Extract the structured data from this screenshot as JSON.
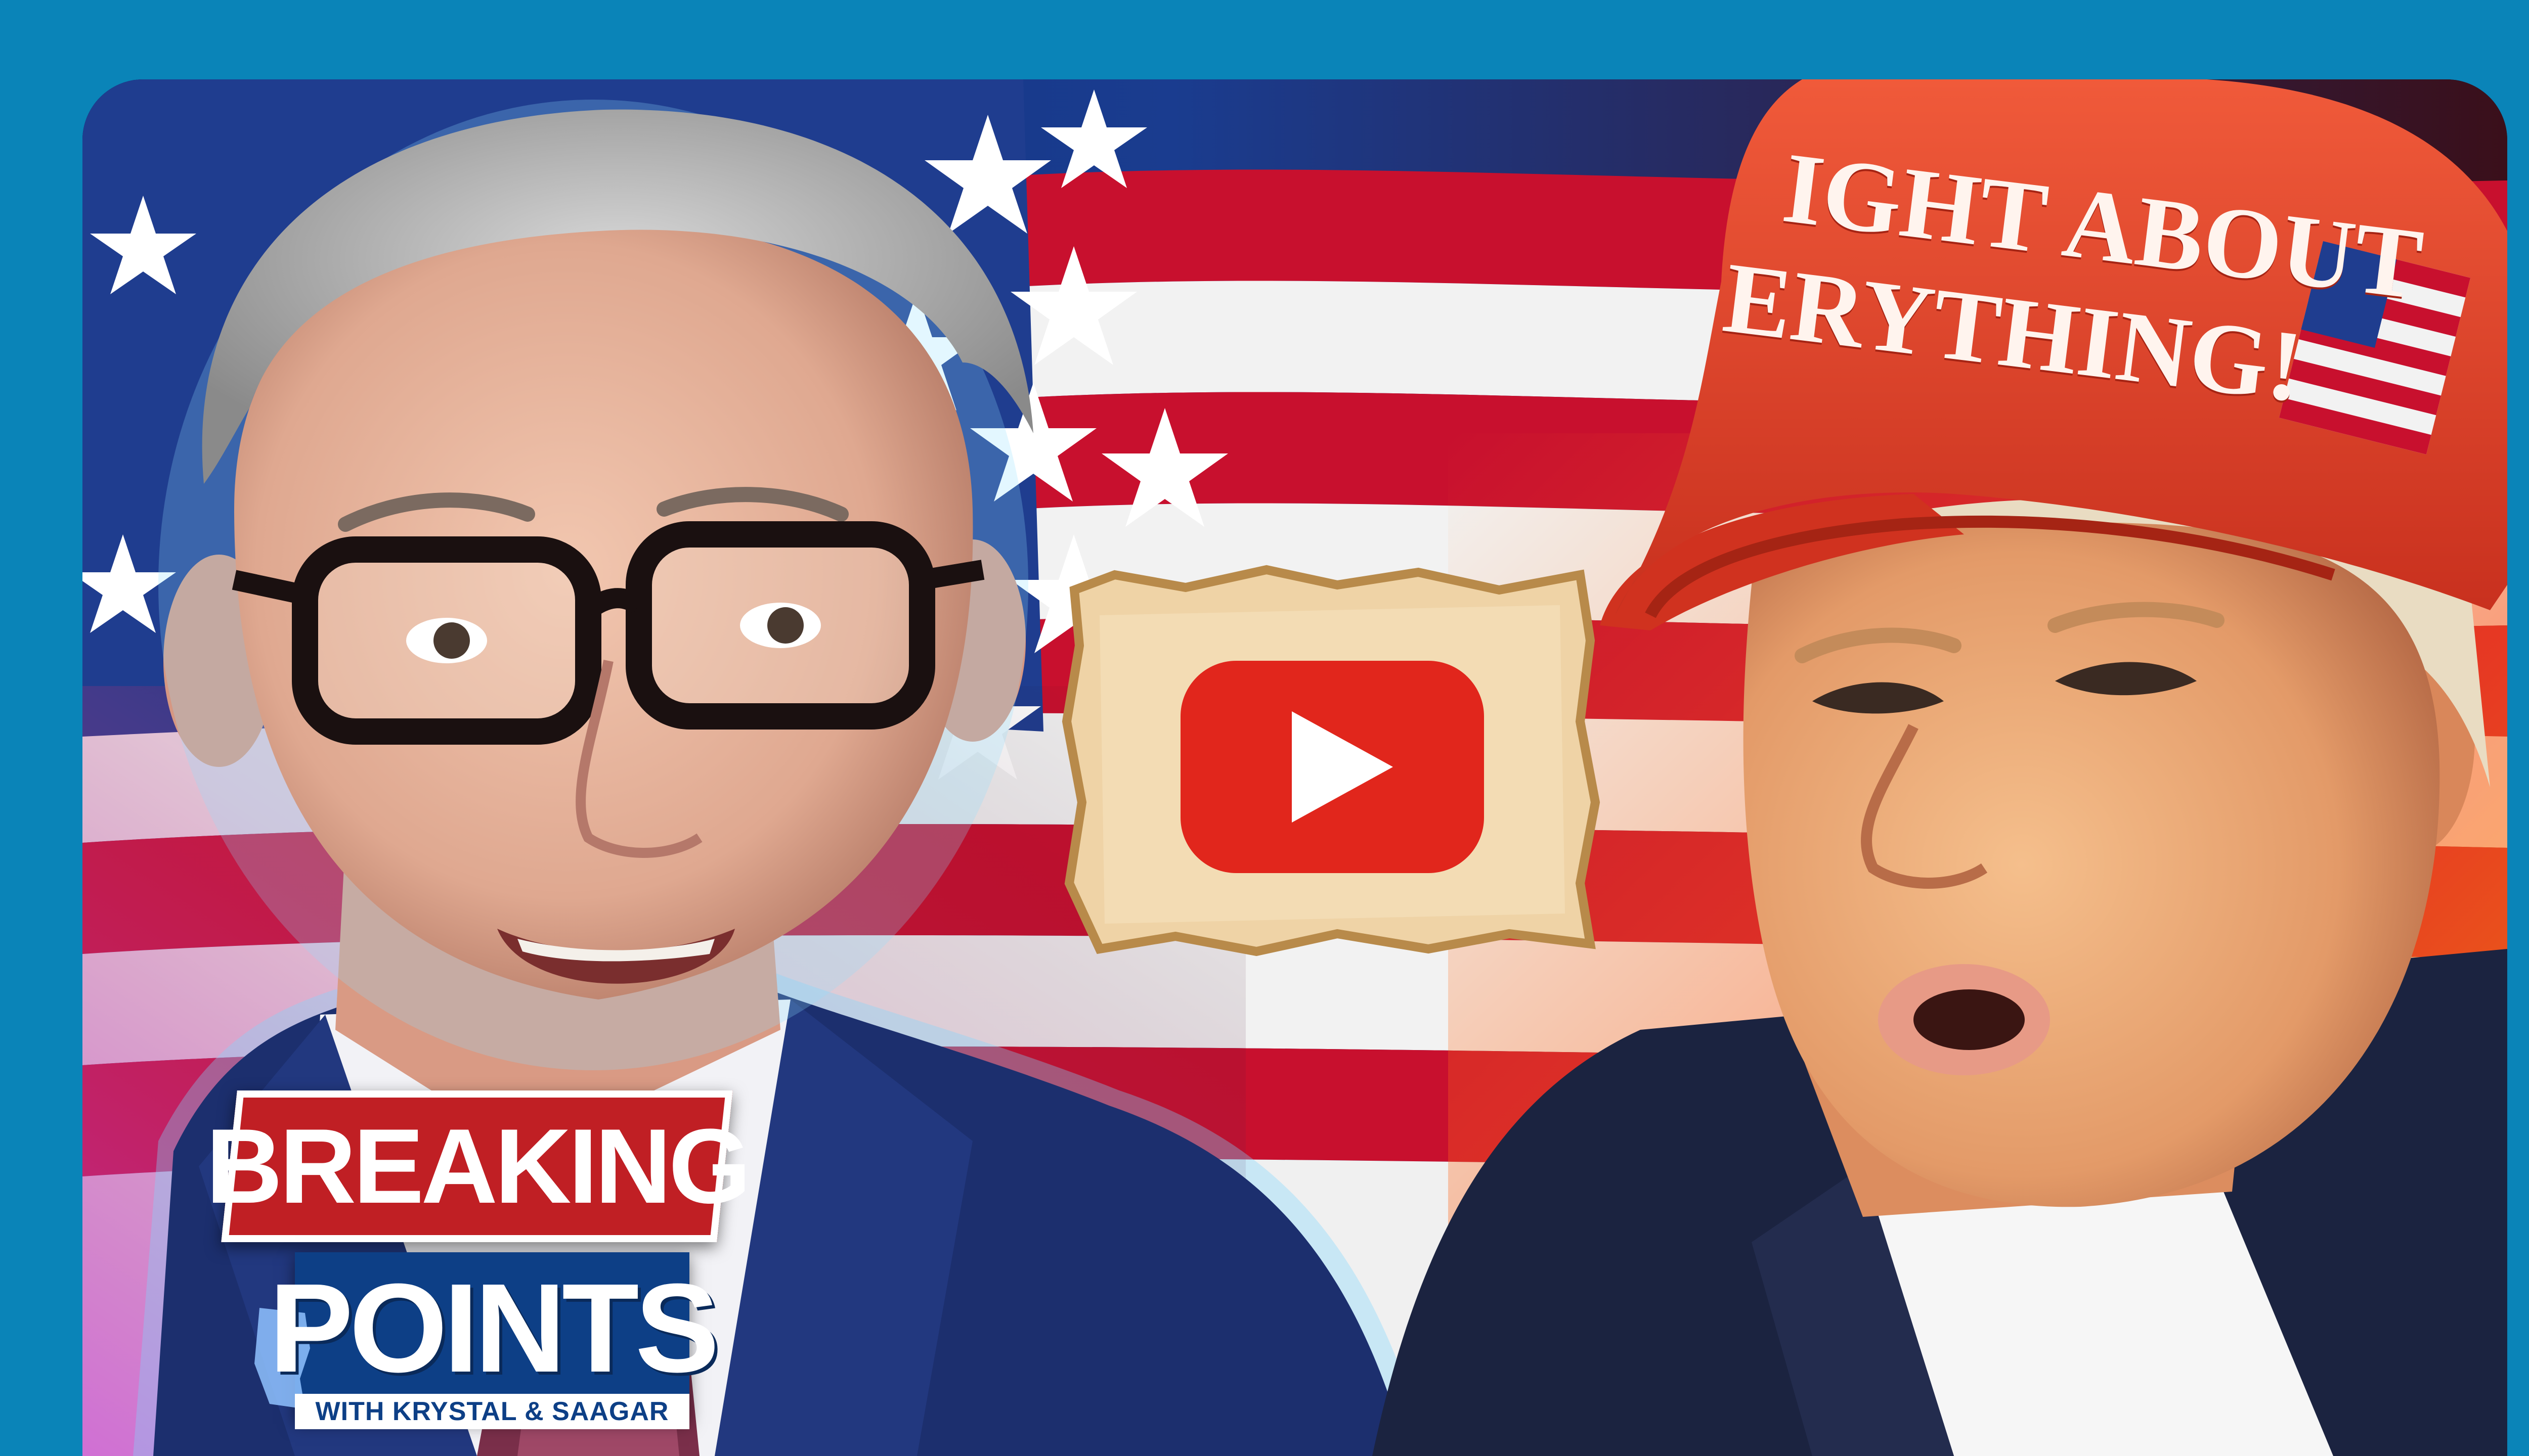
{
  "thumbnail": {
    "hat_line1": "IGHT ABOUT",
    "hat_line2": "ERYTHING!",
    "logo": {
      "line1": "BREAKING",
      "line2": "POINTS",
      "tagline": "WITH KRYSTAL & SAAGAR"
    }
  },
  "colors": {
    "background": "#0a84b8",
    "play_red": "#e1261c",
    "hat_red": "#e0402a",
    "logo_red": "#c01f24",
    "logo_blue": "#0d3f86"
  },
  "icons": {
    "play": "youtube-play-icon"
  }
}
